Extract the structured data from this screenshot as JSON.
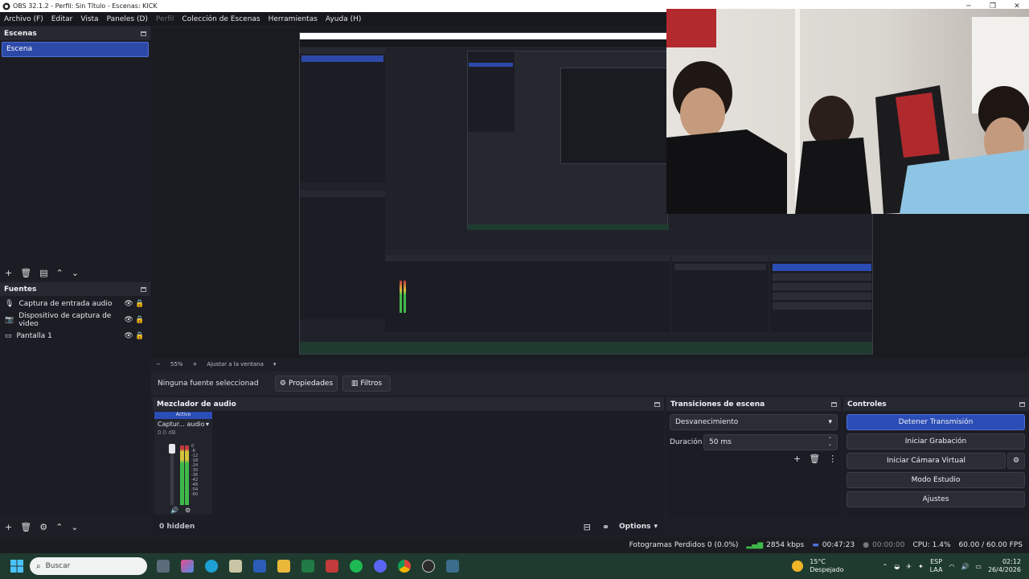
{
  "window": {
    "title": "OBS 32.1.2 - Perfil: Sin Título - Escenas: KICK",
    "minimize": "─",
    "maximize": "❐",
    "close": "✕"
  },
  "menu": [
    "Archivo (F)",
    "Editar",
    "Vista",
    "Paneles (D)",
    "Perfil",
    "Colección de Escenas",
    "Herramientas",
    "Ayuda (H)"
  ],
  "scenes": {
    "title": "Escenas",
    "items": [
      "Escena"
    ]
  },
  "sources": {
    "title": "Fuentes",
    "items": [
      {
        "icon": "microphone-icon",
        "label": "Captura de entrada audio"
      },
      {
        "icon": "camera-icon",
        "label": "Dispositivo de captura de video"
      },
      {
        "icon": "monitor-icon",
        "label": "Pantalla 1"
      }
    ]
  },
  "preview": {
    "zoom": "55%",
    "fit": "Ajustar a la ventana"
  },
  "source_bar": {
    "no_source": "Ninguna fuente seleccionad",
    "properties": "Propiedades",
    "filters": "Filtros"
  },
  "mixer": {
    "title": "Mezclador de audio",
    "active": "Activo",
    "channel": "Captur... audio",
    "db": "0.0 dB",
    "scale": [
      "0",
      "-6",
      "-12",
      "-18",
      "-24",
      "-30",
      "-36",
      "-42",
      "-48",
      "-54",
      "-60"
    ],
    "hidden": "0 hidden",
    "options": "Options"
  },
  "transitions": {
    "title": "Transiciones de escena",
    "selected": "Desvanecimiento",
    "duration_label": "Duración",
    "duration_value": "50 ms"
  },
  "controls": {
    "title": "Controles",
    "stop_stream": "Detener Transmisión",
    "start_record": "Iniciar Grabación",
    "virtual_cam": "Iniciar Cámara Virtual",
    "studio_mode": "Modo Estudio",
    "settings": "Ajustes"
  },
  "status": {
    "dropped": "Fotogramas Perdidos 0 (0.0%)",
    "kbps": "2854 kbps",
    "stream_time": "00:47:23",
    "rec_time": "00:00:00",
    "cpu": "CPU: 1.4%",
    "fps": "60.00 / 60.00 FPS"
  },
  "taskbar": {
    "search_placeholder": "Buscar",
    "weather_temp": "15°C",
    "weather_desc": "Despejado",
    "lang1": "ESP",
    "lang2": "LAA",
    "time": "02:12",
    "date": "26/4/2026"
  },
  "colors": {
    "accent": "#2b4db6",
    "panel": "#1c1d24",
    "taskbar": "#1f3b2f",
    "meter_green": "#3fb94a",
    "meter_yellow": "#d2c23a",
    "meter_red": "#c2383a"
  }
}
